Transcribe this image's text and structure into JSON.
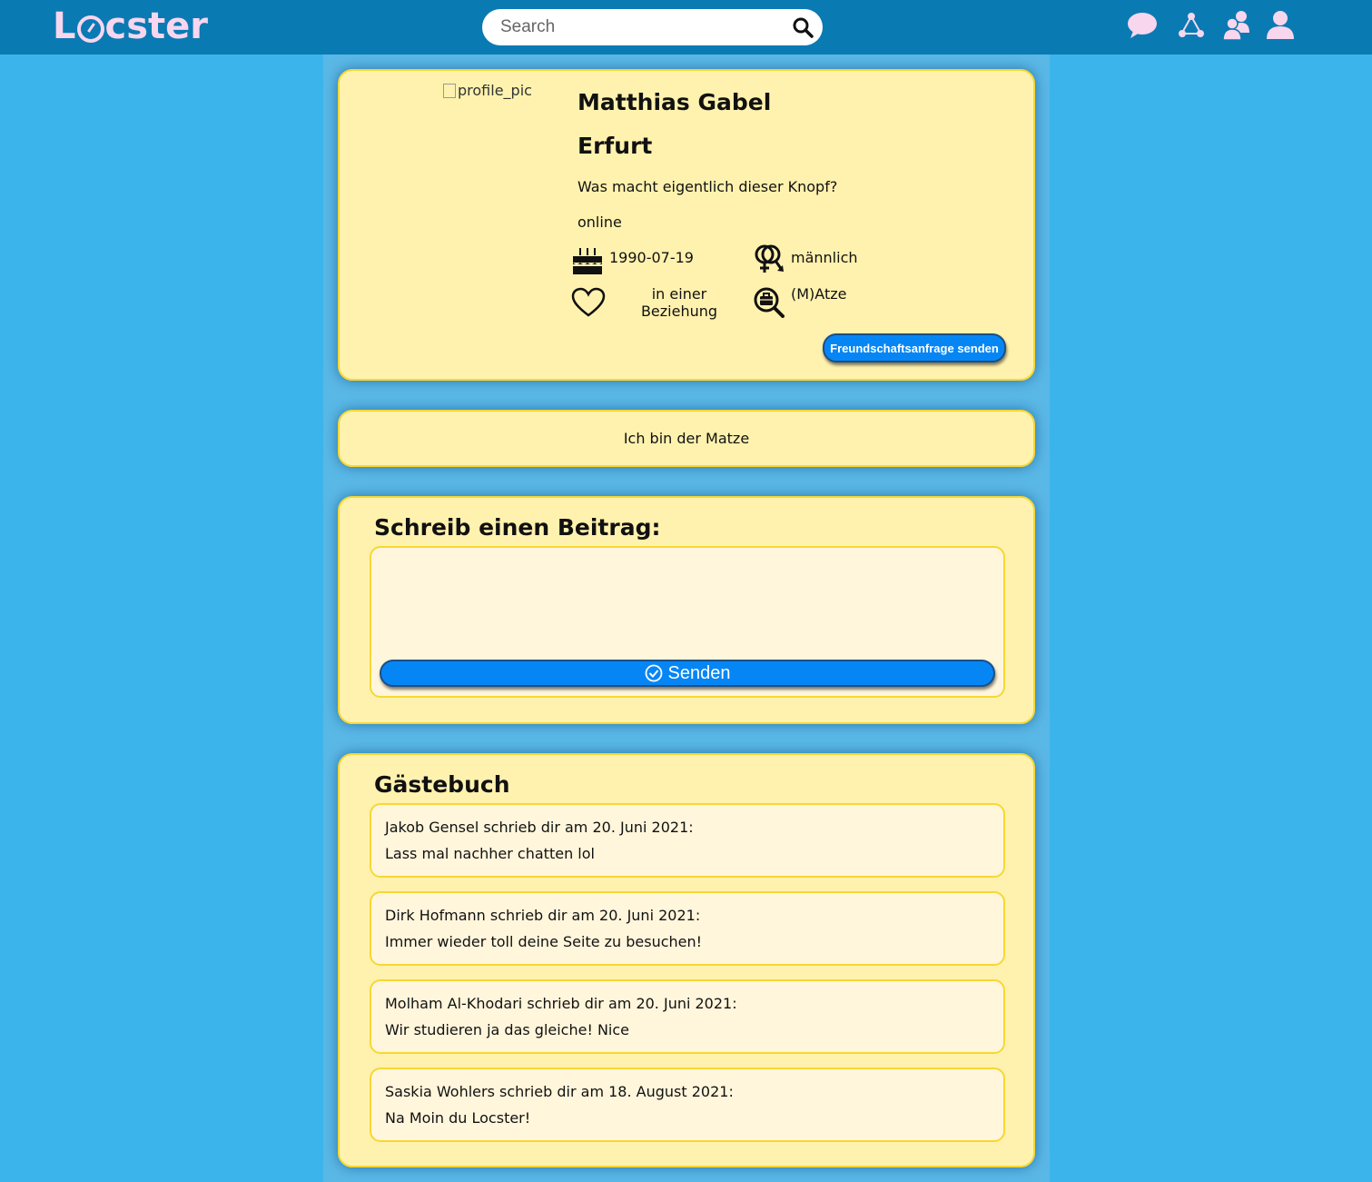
{
  "header": {
    "logo_pre": "L",
    "logo_post": "cster",
    "search_placeholder": "Search"
  },
  "icons": {
    "nav": [
      "chat-icon",
      "network-icon",
      "friends-icon",
      "user-icon"
    ],
    "profile": [
      "birthday-cake-icon",
      "gender-icon",
      "heart-icon",
      "job-search-icon"
    ]
  },
  "profile": {
    "pic_alt": "profile_pic",
    "name": "Matthias Gabel",
    "city": "Erfurt",
    "status": "Was macht eigentlich dieser Knopf?",
    "online": "online",
    "birthday": "1990-07-19",
    "gender": "männlich",
    "relationship": "in einer Beziehung",
    "looking_for": "(M)Atze",
    "friend_request_label": "Freundschaftsanfrage senden"
  },
  "about": {
    "text": "Ich bin der Matze"
  },
  "post": {
    "title": "Schreib einen Beitrag:",
    "send_label": "Senden"
  },
  "guestbook": {
    "title": "Gästebuch",
    "entries": [
      {
        "head": "Jakob Gensel schrieb dir am 20. Juni 2021:",
        "msg": "Lass mal nachher chatten lol"
      },
      {
        "head": "Dirk Hofmann schrieb dir am 20. Juni 2021:",
        "msg": "Immer wieder toll deine Seite zu besuchen!"
      },
      {
        "head": "Molham Al-Khodari schrieb dir am 20. Juni 2021:",
        "msg": "Wir studieren ja das gleiche! Nice"
      },
      {
        "head": "Saskia Wohlers schrieb dir am 18. August 2021:",
        "msg": "Na Moin du Locster!"
      }
    ]
  },
  "colors": {
    "topbar": "#0a7ab3",
    "background": "#3bb4ec",
    "card": "#fff2ae",
    "card_border": "#f7d733",
    "button": "#0686f5",
    "logo": "#f7d6ee"
  }
}
